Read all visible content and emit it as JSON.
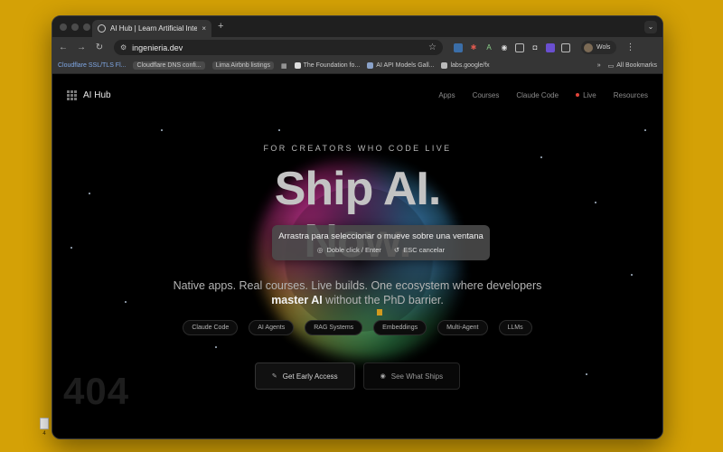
{
  "browser": {
    "tab_title": "AI Hub | Learn Artificial Intelli",
    "tab_close": "×",
    "new_tab": "+",
    "tab_menu": "⌄",
    "url": "ingenieria.dev",
    "profile_name": "Wols",
    "bookmarks": [
      "Cloudflare SSL/TLS Fl...",
      "Cloudflare DNS confi...",
      "Lima Airbnb listings",
      "The Foundation fo...",
      "AI API Models Gall...",
      "labs.google/fx"
    ],
    "bookmarks_more": "»",
    "all_bookmarks": "All Bookmarks"
  },
  "site": {
    "logo_text": "AI Hub",
    "nav": [
      "Apps",
      "Courses",
      "Claude Code",
      "Live",
      "Resources"
    ],
    "eyebrow": "FOR CREATORS WHO CODE LIVE",
    "headline_1": "Ship AI.",
    "headline_2": "Now.",
    "subtitle_line1": "Native apps. Real courses. Live builds. One ecosystem where developers",
    "subtitle_bold": "master AI",
    "subtitle_line2_rest": " without the PhD barrier.",
    "pills": [
      "Claude Code",
      "AI Agents",
      "RAG Systems",
      "Embeddings",
      "Multi-Agent",
      "LLMs"
    ],
    "cta_primary": "Get Early Access",
    "cta_secondary": "See What Ships",
    "bg_text": "404"
  },
  "overlay": {
    "message": "Arrastra para seleccionar o mueve sobre una ventana",
    "hint_enter": "Doble click / Enter",
    "hint_esc": "ESC cancelar"
  },
  "desktop": {
    "file_label": "4"
  },
  "colors": {
    "desktop": "#d4a106",
    "accent_live": "#e0443a",
    "cursor_caret": "#d29a1e"
  }
}
